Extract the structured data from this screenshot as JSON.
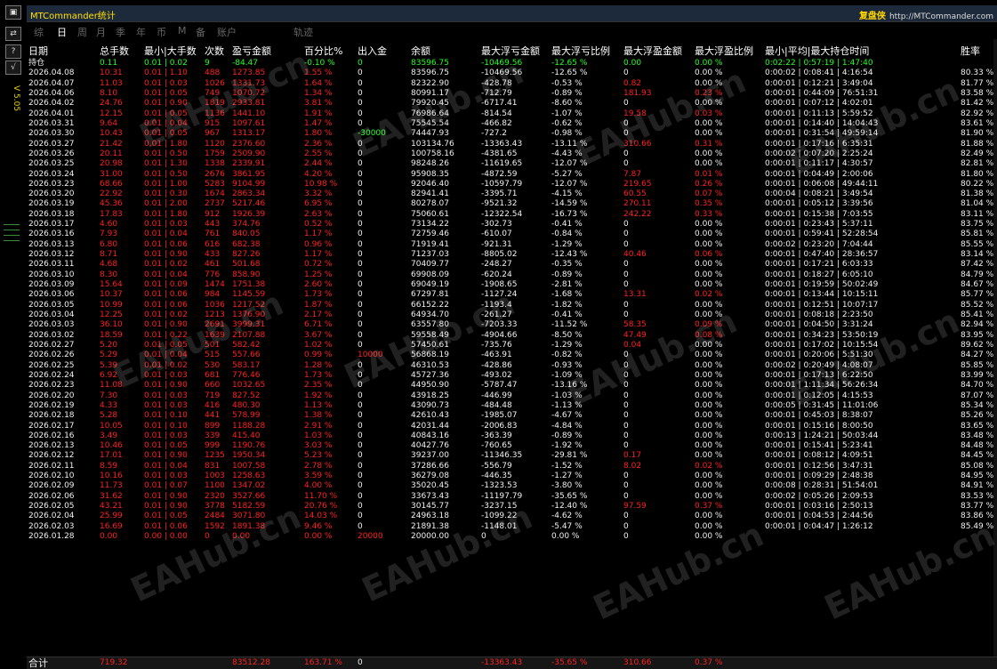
{
  "app": {
    "title": "MTCommander统计",
    "brand_cn": "复盘侠",
    "brand_url": "http://MTCommander.com",
    "version": "V 5.05"
  },
  "toolbar": [
    "?",
    "√"
  ],
  "tabs": [
    {
      "label": "综",
      "active": false
    },
    {
      "label": "日",
      "active": true
    },
    {
      "label": "周",
      "active": false
    },
    {
      "label": "月",
      "active": false
    },
    {
      "label": "季",
      "active": false
    },
    {
      "label": "年",
      "active": false
    },
    {
      "label": "币",
      "active": false
    },
    {
      "label": "M",
      "active": false
    },
    {
      "label": "备",
      "active": false
    },
    {
      "label": "账户",
      "active": false
    },
    {
      "label": "轨迹",
      "active": false
    }
  ],
  "columns": [
    "日期",
    "总手数",
    "最小|大手数",
    "次数",
    "盈亏金额",
    "百分比%",
    "出入金",
    "余额",
    "最大浮亏金额",
    "最大浮亏比例",
    "最大浮盈金额",
    "最大浮盈比例",
    "最小|平均|最大持仓时间",
    "胜率"
  ],
  "holding": [
    "持仓",
    "0.11",
    "0.01 | 0.02",
    "9",
    "-84.47",
    "-0.10 %",
    "0",
    "83596.75",
    "-10469.56",
    "-12.65 %",
    "0.00",
    "0.00 %",
    "0:02:22 | 0:57:19 | 1:47:40",
    ""
  ],
  "rows": [
    [
      "2026.04.08",
      "10.31",
      "0.01 | 1.10",
      "488",
      "1273.85",
      "1.55 %",
      "0",
      "83596.75",
      "-10469.56",
      "-12.65 %",
      "0",
      "0.00 %",
      "0:00:02 | 0:08:41 | 4:16:54",
      "80.33 %"
    ],
    [
      "2026.04.07",
      "11.03",
      "0.01 | 0.03",
      "1026",
      "1331.73",
      "1.64 %",
      "0",
      "82322.90",
      "-428.78",
      "-0.53 %",
      "0.82",
      "0.00 %",
      "0:00:01 | 0:12:21 | 3:49:04",
      "81.77 %"
    ],
    [
      "2026.04.06",
      "8.10",
      "0.01 | 0.05",
      "749",
      "1070.72",
      "1.34 %",
      "0",
      "80991.17",
      "-712.79",
      "-0.89 %",
      "181.93",
      "0.23 %",
      "0:00:01 | 0:44:09 | 76:51:31",
      "83.58 %"
    ],
    [
      "2026.04.02",
      "24.76",
      "0.01 | 0.90",
      "1819",
      "2933.81",
      "3.81 %",
      "0",
      "79920.45",
      "-6717.41",
      "-8.60 %",
      "0",
      "0.00 %",
      "0:00:01 | 0:07:12 | 4:02:01",
      "81.42 %"
    ],
    [
      "2026.04.01",
      "12.15",
      "0.01 | 0.05",
      "1136",
      "1441.10",
      "1.91 %",
      "0",
      "76986.64",
      "-814.54",
      "-1.07 %",
      "19.58",
      "0.03 %",
      "0:00:01 | 0:11:13 | 5:59:52",
      "82.92 %"
    ],
    [
      "2026.03.31",
      "9.64",
      "0.01 | 0.04",
      "915",
      "1097.61",
      "1.47 %",
      "0",
      "75545.54",
      "-466.82",
      "-0.62 %",
      "0",
      "0.00 %",
      "0:00:01 | 0:14:40 | 14:04:43",
      "83.61 %"
    ],
    [
      "2026.03.30",
      "10.43",
      "0.01 | 0.05",
      "967",
      "1313.17",
      "1.80 %",
      "-30000",
      "74447.93",
      "-727.2",
      "-0.98 %",
      "0",
      "0.00 %",
      "0:00:01 | 0:31:54 | 49:59:14",
      "81.90 %"
    ],
    [
      "2026.03.27",
      "21.42",
      "0.01 | 1.80",
      "1120",
      "2376.60",
      "2.36 %",
      "0",
      "103134.76",
      "-13363.43",
      "-13.11 %",
      "310.66",
      "0.31 %",
      "0:00:01 | 0:17:16 | 6:35:31",
      "81.88 %"
    ],
    [
      "2026.03.26",
      "20.11",
      "0.01 | 0.50",
      "1759",
      "2509.90",
      "2.55 %",
      "0",
      "100758.16",
      "-4381.65",
      "-4.43 %",
      "0",
      "0.00 %",
      "0:00:02 | 0:07:20 | 2:25:24",
      "82.49 %"
    ],
    [
      "2026.03.25",
      "20.98",
      "0.01 | 1.30",
      "1338",
      "2339.91",
      "2.44 %",
      "0",
      "98248.26",
      "-11619.65",
      "-12.07 %",
      "0",
      "0.00 %",
      "0:00:01 | 0:11:17 | 4:30:57",
      "82.81 %"
    ],
    [
      "2026.03.24",
      "31.00",
      "0.01 | 0.50",
      "2676",
      "3861.95",
      "4.20 %",
      "0",
      "95908.35",
      "-4872.59",
      "-5.27 %",
      "7.87",
      "0.01 %",
      "0:00:01 | 0:04:49 | 2:00:06",
      "81.80 %"
    ],
    [
      "2026.03.23",
      "68.66",
      "0.01 | 1.00",
      "5283",
      "9104.99",
      "10.98 %",
      "0",
      "92046.40",
      "-10597.79",
      "-12.07 %",
      "219.65",
      "0.26 %",
      "0:00:01 | 0:06:08 | 49:44:11",
      "80.22 %"
    ],
    [
      "2026.03.20",
      "22.92",
      "0.01 | 0.30",
      "1674",
      "2863.34",
      "3.32 %",
      "0",
      "82941.41",
      "-3395.71",
      "-4.15 %",
      "60.55",
      "0.07 %",
      "0:00:04 | 0:08:21 | 3:49:54",
      "81.38 %"
    ],
    [
      "2026.03.19",
      "45.36",
      "0.01 | 2.00",
      "2737",
      "5217.46",
      "6.95 %",
      "0",
      "80278.07",
      "-9521.32",
      "-14.59 %",
      "270.11",
      "0.35 %",
      "0:00:01 | 0:05:12 | 3:39:56",
      "81.04 %"
    ],
    [
      "2026.03.18",
      "17.83",
      "0.01 | 1.80",
      "912",
      "1926.39",
      "2.63 %",
      "0",
      "75060.61",
      "-12322.54",
      "-16.73 %",
      "242.22",
      "0.33 %",
      "0:00:01 | 0:15:38 | 7:03:55",
      "83.11 %"
    ],
    [
      "2026.03.17",
      "4.60",
      "0.01 | 0.03",
      "443",
      "374.76",
      "0.52 %",
      "0",
      "73134.22",
      "-302.73",
      "-0.41 %",
      "0",
      "0.00 %",
      "0:00:01 | 0:23:43 | 5:37:11",
      "83.75 %"
    ],
    [
      "2026.03.16",
      "7.93",
      "0.01 | 0.04",
      "761",
      "840.05",
      "1.17 %",
      "0",
      "72759.46",
      "-610.07",
      "-0.84 %",
      "0",
      "0.00 %",
      "0:00:01 | 0:59:41 | 52:28:54",
      "85.81 %"
    ],
    [
      "2026.03.13",
      "6.80",
      "0.01 | 0.06",
      "616",
      "682.38",
      "0.96 %",
      "0",
      "71919.41",
      "-921.31",
      "-1.29 %",
      "0",
      "0.00 %",
      "0:00:02 | 0:23:20 | 7:04:44",
      "85.55 %"
    ],
    [
      "2026.03.12",
      "8.71",
      "0.01 | 0.90",
      "433",
      "827.26",
      "1.17 %",
      "0",
      "71237.03",
      "-8805.02",
      "-12.43 %",
      "40.46",
      "0.06 %",
      "0:00:01 | 0:47:40 | 28:36:57",
      "83.14 %"
    ],
    [
      "2026.03.11",
      "4.68",
      "0.01 | 0.02",
      "461",
      "501.68",
      "0.72 %",
      "0",
      "70409.77",
      "-248.27",
      "-0.35 %",
      "0",
      "0.00 %",
      "0:00:01 | 0:17:21 | 6:03:33",
      "87.42 %"
    ],
    [
      "2026.03.10",
      "8.30",
      "0.01 | 0.04",
      "776",
      "858.90",
      "1.25 %",
      "0",
      "69908.09",
      "-620.24",
      "-0.89 %",
      "0",
      "0.00 %",
      "0:00:01 | 0:18:27 | 6:05:10",
      "84.79 %"
    ],
    [
      "2026.03.09",
      "15.64",
      "0.01 | 0.09",
      "1474",
      "1751.38",
      "2.60 %",
      "0",
      "69049.19",
      "-1908.65",
      "-2.81 %",
      "0",
      "0.00 %",
      "0:00:01 | 0:19:59 | 50:02:49",
      "84.67 %"
    ],
    [
      "2026.03.06",
      "10.37",
      "0.01 | 0.06",
      "984",
      "1145.59",
      "1.73 %",
      "0",
      "67297.81",
      "-1127.24",
      "-1.68 %",
      "13.31",
      "0.02 %",
      "0:00:01 | 0:13:44 | 10:15:11",
      "85.77 %"
    ],
    [
      "2026.03.05",
      "10.99",
      "0.01 | 0.06",
      "1036",
      "1217.52",
      "1.87 %",
      "0",
      "66152.22",
      "-1193.4",
      "-1.82 %",
      "0",
      "0.00 %",
      "0:00:01 | 0:12:51 | 10:07:17",
      "85.52 %"
    ],
    [
      "2026.03.04",
      "12.25",
      "0.01 | 0.02",
      "1213",
      "1376.90",
      "2.17 %",
      "0",
      "64934.70",
      "-261.27",
      "-0.41 %",
      "0",
      "0.00 %",
      "0:00:01 | 0:08:18 | 2:23:50",
      "85.41 %"
    ],
    [
      "2026.03.03",
      "36.10",
      "0.01 | 0.90",
      "2691",
      "3999.31",
      "6.71 %",
      "0",
      "63557.80",
      "-7203.33",
      "-11.52 %",
      "58.35",
      "0.09 %",
      "0:00:01 | 0:04:50 | 3:31:24",
      "82.94 %"
    ],
    [
      "2026.03.02",
      "18.59",
      "0.01 | 0.22",
      "1639",
      "2107.88",
      "3.67 %",
      "0",
      "59558.49",
      "-4904.66",
      "-8.50 %",
      "47.49",
      "0.08 %",
      "0:00:01 | 0:34:23 | 53:50:19",
      "83.95 %"
    ],
    [
      "2026.02.27",
      "5.20",
      "0.01 | 0.05",
      "501",
      "582.42",
      "1.02 %",
      "0",
      "57450.61",
      "-735.76",
      "-1.29 %",
      "0.04",
      "0.00 %",
      "0:00:01 | 0:17:02 | 10:15:54",
      "89.62 %"
    ],
    [
      "2026.02.26",
      "5.29",
      "0.01 | 0.04",
      "515",
      "557.66",
      "0.99 %",
      "10000",
      "56868.19",
      "-463.91",
      "-0.82 %",
      "0",
      "0.00 %",
      "0:00:01 | 0:20:06 | 5:51:30",
      "84.27 %"
    ],
    [
      "2026.02.25",
      "5.39",
      "0.01 | 0.02",
      "530",
      "583.17",
      "1.28 %",
      "0",
      "46310.53",
      "-428.86",
      "-0.93 %",
      "0",
      "0.00 %",
      "0:00:02 | 0:20:49 | 4:08:07",
      "85.85 %"
    ],
    [
      "2026.02.24",
      "6.92",
      "0.01 | 0.03",
      "681",
      "776.46",
      "1.73 %",
      "0",
      "45727.36",
      "-493.02",
      "-1.09 %",
      "0",
      "0.00 %",
      "0:00:01 | 0:17:13 | 6:22:50",
      "83.99 %"
    ],
    [
      "2026.02.23",
      "11.08",
      "0.01 | 0.90",
      "660",
      "1032.65",
      "2.35 %",
      "0",
      "44950.90",
      "-5787.47",
      "-13.16 %",
      "0",
      "0.00 %",
      "0:00:01 | 1:11:34 | 56:26:34",
      "84.70 %"
    ],
    [
      "2026.02.20",
      "7.30",
      "0.01 | 0.03",
      "719",
      "827.52",
      "1.92 %",
      "0",
      "43918.25",
      "-446.99",
      "-1.03 %",
      "0",
      "0.00 %",
      "0:00:01 | 0:12:05 | 4:15:53",
      "87.07 %"
    ],
    [
      "2026.02.19",
      "4.33",
      "0.01 | 0.03",
      "416",
      "480.30",
      "1.13 %",
      "0",
      "43090.73",
      "-484.48",
      "-1.13 %",
      "0",
      "0.00 %",
      "0:00:05 | 0:31:45 | 11:01:06",
      "85.34 %"
    ],
    [
      "2026.02.18",
      "5.28",
      "0.01 | 0.10",
      "441",
      "578.99",
      "1.38 %",
      "0",
      "42610.43",
      "-1985.07",
      "-4.67 %",
      "0",
      "0.00 %",
      "0:00:01 | 0:45:03 | 8:38:07",
      "85.26 %"
    ],
    [
      "2026.02.17",
      "10.05",
      "0.01 | 0.10",
      "899",
      "1188.28",
      "2.91 %",
      "0",
      "42031.44",
      "-2006.83",
      "-4.84 %",
      "0",
      "0.00 %",
      "0:00:01 | 0:15:16 | 8:00:50",
      "83.65 %"
    ],
    [
      "2026.02.16",
      "3.49",
      "0.01 | 0.03",
      "339",
      "415.40",
      "1.03 %",
      "0",
      "40843.16",
      "-363.39",
      "-0.89 %",
      "0",
      "0.00 %",
      "0:00:13 | 1:24:21 | 50:03:44",
      "83.48 %"
    ],
    [
      "2026.02.13",
      "10.46",
      "0.01 | 0.05",
      "999",
      "1190.76",
      "3.03 %",
      "0",
      "40427.76",
      "-760.65",
      "-1.92 %",
      "0",
      "0.00 %",
      "0:00:01 | 0:15:41 | 5:23:41",
      "84.48 %"
    ],
    [
      "2026.02.12",
      "17.01",
      "0.01 | 0.90",
      "1235",
      "1950.34",
      "5.23 %",
      "0",
      "39237.00",
      "-11346.35",
      "-29.81 %",
      "0.17",
      "0.00 %",
      "0:00:01 | 0:08:12 | 4:09:51",
      "84.45 %"
    ],
    [
      "2026.02.11",
      "8.59",
      "0.01 | 0.04",
      "831",
      "1007.58",
      "2.78 %",
      "0",
      "37286.66",
      "-556.79",
      "-1.52 %",
      "8.02",
      "0.02 %",
      "0:00:01 | 0:12:56 | 3:47:31",
      "85.08 %"
    ],
    [
      "2026.02.10",
      "10.16",
      "0.01 | 0.03",
      "1003",
      "1258.63",
      "3.59 %",
      "0",
      "36279.08",
      "-446.35",
      "-1.27 %",
      "0",
      "0.00 %",
      "0:00:01 | 0:09:29 | 2:48:38",
      "84.95 %"
    ],
    [
      "2026.02.09",
      "11.73",
      "0.01 | 0.07",
      "1100",
      "1347.02",
      "4.00 %",
      "0",
      "35020.45",
      "-1323.53",
      "-3.80 %",
      "0",
      "0.00 %",
      "0:00:08 | 0:28:31 | 51:54:01",
      "84.91 %"
    ],
    [
      "2026.02.06",
      "31.62",
      "0.01 | 0.90",
      "2320",
      "3527.66",
      "11.70 %",
      "0",
      "33673.43",
      "-11197.79",
      "-35.65 %",
      "0",
      "0.00 %",
      "0:00:02 | 0:05:26 | 2:09:53",
      "83.53 %"
    ],
    [
      "2026.02.05",
      "43.21",
      "0.01 | 0.90",
      "3778",
      "5182.59",
      "20.76 %",
      "0",
      "30145.77",
      "-3237.15",
      "-12.40 %",
      "97.59",
      "0.37 %",
      "0:00:01 | 0:03:16 | 2:50:13",
      "83.77 %"
    ],
    [
      "2026.02.04",
      "25.99",
      "0.01 | 0.05",
      "2484",
      "3071.80",
      "14.03 %",
      "0",
      "24963.18",
      "-1099.22",
      "-4.62 %",
      "0",
      "0.00 %",
      "0:00:01 | 0:04:53 | 2:44:56",
      "83.86 %"
    ],
    [
      "2026.02.03",
      "16.69",
      "0.01 | 0.06",
      "1592",
      "1891.38",
      "9.46 %",
      "0",
      "21891.38",
      "-1148.01",
      "-5.47 %",
      "0",
      "0.00 %",
      "0:00:01 | 0:04:47 | 1:26:12",
      "85.49 %"
    ],
    [
      "2026.01.28",
      "0.00",
      "0.00 | 0.00",
      "0",
      "0.00",
      "0.00 %",
      "20000",
      "20000.00",
      "0",
      "0.00 %",
      "0",
      "0.00 %",
      "",
      ""
    ]
  ],
  "total": [
    "合计",
    "719.32",
    "",
    "",
    "83512.28",
    "163.71 %",
    "0",
    "",
    "-13363.43",
    "-35.65 %",
    "310.66",
    "0.37 %",
    "",
    ""
  ],
  "watermark": "EAHub.cn",
  "colors": {
    "positive": "#ff2020",
    "neutral": "#f0f0f0",
    "holding": "#22ff22",
    "brand": "#ffd700"
  }
}
